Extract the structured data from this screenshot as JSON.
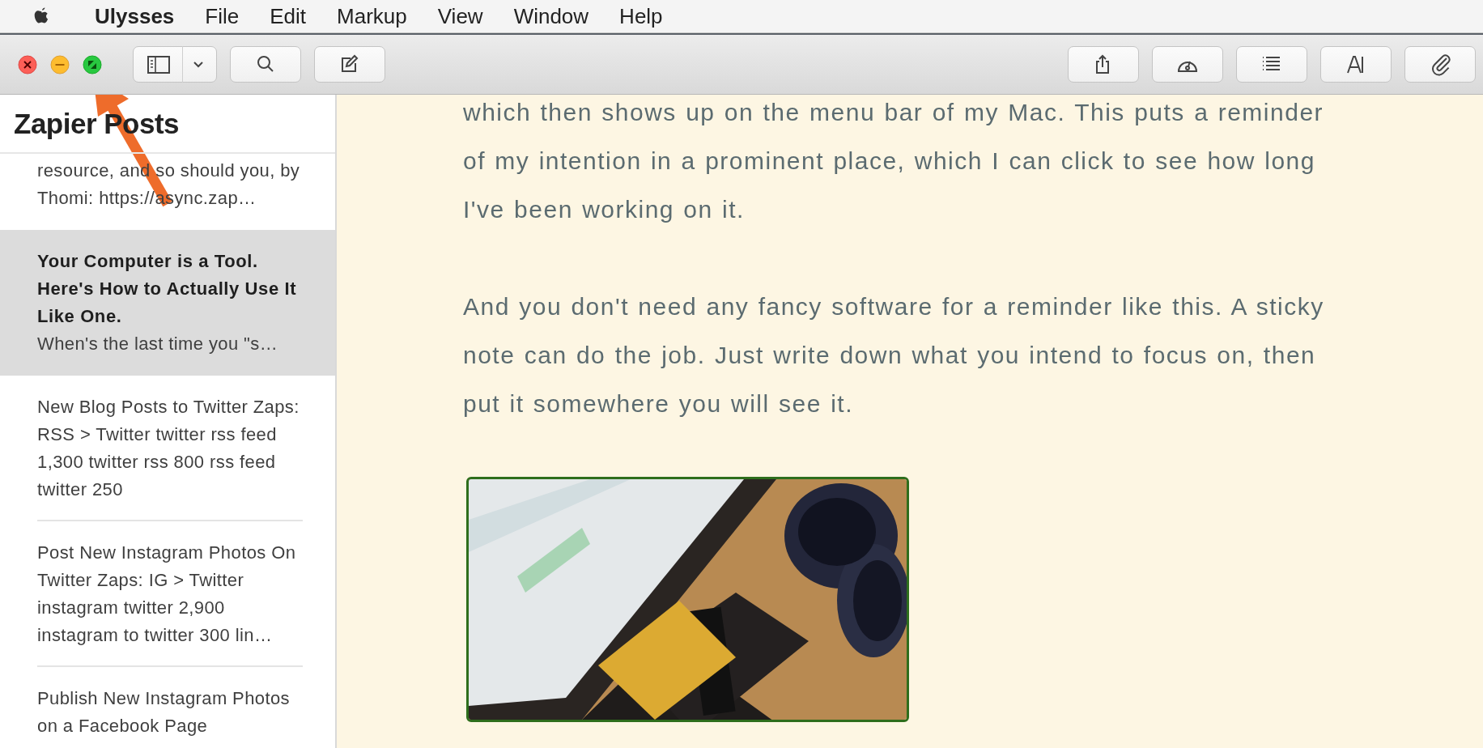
{
  "menu_bar": {
    "app_name": "Ulysses",
    "items": [
      "File",
      "Edit",
      "Markup",
      "View",
      "Window",
      "Help"
    ]
  },
  "window_controls": [
    {
      "kind": "close"
    },
    {
      "kind": "minimize"
    },
    {
      "kind": "fullscreen"
    }
  ],
  "toolbar": {
    "left": [
      {
        "kind": "sidebar-toggle"
      },
      {
        "kind": "search"
      },
      {
        "kind": "compose"
      }
    ],
    "right": [
      {
        "kind": "share"
      },
      {
        "kind": "dashboard"
      },
      {
        "kind": "outline"
      },
      {
        "kind": "font"
      },
      {
        "kind": "attach"
      }
    ]
  },
  "sidebar": {
    "title": "Zapier Posts",
    "items": [
      {
        "text": "resource, and so should you, by Thomi: https://async.zap…",
        "selected": false
      },
      {
        "title": "Your Computer is a Tool. Here's How to Actually Use It Like One.",
        "text": "When's the last time you \"s…",
        "selected": true
      },
      {
        "text": "New Blog Posts to Twitter Zaps: RSS > Twitter twitter rss feed 1,300 twitter rss 800 rss feed twitter 250",
        "selected": false
      },
      {
        "text": "Post New Instagram Photos On Twitter Zaps: IG > Twitter instagram twitter 2,900 instagram to twitter 300 lin…",
        "selected": false
      },
      {
        "text": "Publish New Instagram Photos on a Facebook Page",
        "selected": false
      }
    ]
  },
  "editor": {
    "paragraphs": [
      "which then shows up on the menu bar of my Mac. This puts a reminder of my intention in a prominent place, which I can click to see how long I've been working on it.",
      "And you don't need any fancy software for a reminder like this. A sticky note can do the job. Just write down what you intend to focus on, then put it somewhere you will see it."
    ],
    "image": {
      "kind": "picture"
    }
  },
  "annotation": {
    "kind": "arrow"
  }
}
